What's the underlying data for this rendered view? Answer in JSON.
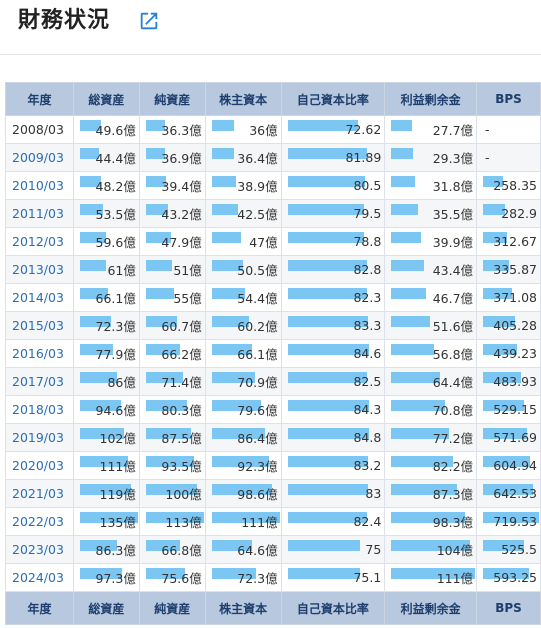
{
  "header": {
    "title": "財務状況",
    "link_icon": "external-link-icon"
  },
  "table": {
    "columns": [
      "年度",
      "総資産",
      "純資産",
      "株主資本",
      "自己資本比率",
      "利益剰余金",
      "BPS"
    ],
    "bar_color": "#7cc6f3",
    "max": {
      "total_assets": 135,
      "net_assets": 113,
      "shareholders_equity": 111,
      "equity_ratio": 100,
      "retained_earnings": 111,
      "bps": 719.53
    },
    "rows": [
      {
        "year": "2008/03",
        "linked": false,
        "total_assets": "49.6億",
        "net_assets": "36.3億",
        "shareholders_equity": "36億",
        "equity_ratio": "72.62",
        "retained_earnings": "27.7億",
        "bps": "-"
      },
      {
        "year": "2009/03",
        "linked": true,
        "total_assets": "44.4億",
        "net_assets": "36.9億",
        "shareholders_equity": "36.4億",
        "equity_ratio": "81.89",
        "retained_earnings": "29.3億",
        "bps": "-"
      },
      {
        "year": "2010/03",
        "linked": true,
        "total_assets": "48.2億",
        "net_assets": "39.4億",
        "shareholders_equity": "38.9億",
        "equity_ratio": "80.5",
        "retained_earnings": "31.8億",
        "bps": "258.35"
      },
      {
        "year": "2011/03",
        "linked": true,
        "total_assets": "53.5億",
        "net_assets": "43.2億",
        "shareholders_equity": "42.5億",
        "equity_ratio": "79.5",
        "retained_earnings": "35.5億",
        "bps": "282.9"
      },
      {
        "year": "2012/03",
        "linked": true,
        "total_assets": "59.6億",
        "net_assets": "47.9億",
        "shareholders_equity": "47億",
        "equity_ratio": "78.8",
        "retained_earnings": "39.9億",
        "bps": "312.67"
      },
      {
        "year": "2013/03",
        "linked": true,
        "total_assets": "61億",
        "net_assets": "51億",
        "shareholders_equity": "50.5億",
        "equity_ratio": "82.8",
        "retained_earnings": "43.4億",
        "bps": "335.87"
      },
      {
        "year": "2014/03",
        "linked": true,
        "total_assets": "66.1億",
        "net_assets": "55億",
        "shareholders_equity": "54.4億",
        "equity_ratio": "82.3",
        "retained_earnings": "46.7億",
        "bps": "371.08"
      },
      {
        "year": "2015/03",
        "linked": true,
        "total_assets": "72.3億",
        "net_assets": "60.7億",
        "shareholders_equity": "60.2億",
        "equity_ratio": "83.3",
        "retained_earnings": "51.6億",
        "bps": "405.28"
      },
      {
        "year": "2016/03",
        "linked": true,
        "total_assets": "77.9億",
        "net_assets": "66.2億",
        "shareholders_equity": "66.1億",
        "equity_ratio": "84.6",
        "retained_earnings": "56.8億",
        "bps": "439.23"
      },
      {
        "year": "2017/03",
        "linked": true,
        "total_assets": "86億",
        "net_assets": "71.4億",
        "shareholders_equity": "70.9億",
        "equity_ratio": "82.5",
        "retained_earnings": "64.4億",
        "bps": "483.93"
      },
      {
        "year": "2018/03",
        "linked": true,
        "total_assets": "94.6億",
        "net_assets": "80.3億",
        "shareholders_equity": "79.6億",
        "equity_ratio": "84.3",
        "retained_earnings": "70.8億",
        "bps": "529.15"
      },
      {
        "year": "2019/03",
        "linked": true,
        "total_assets": "102億",
        "net_assets": "87.5億",
        "shareholders_equity": "86.4億",
        "equity_ratio": "84.8",
        "retained_earnings": "77.2億",
        "bps": "571.69"
      },
      {
        "year": "2020/03",
        "linked": true,
        "total_assets": "111億",
        "net_assets": "93.5億",
        "shareholders_equity": "92.3億",
        "equity_ratio": "83.2",
        "retained_earnings": "82.2億",
        "bps": "604.94"
      },
      {
        "year": "2021/03",
        "linked": true,
        "total_assets": "119億",
        "net_assets": "100億",
        "shareholders_equity": "98.6億",
        "equity_ratio": "83",
        "retained_earnings": "87.3億",
        "bps": "642.53"
      },
      {
        "year": "2022/03",
        "linked": true,
        "total_assets": "135億",
        "net_assets": "113億",
        "shareholders_equity": "111億",
        "equity_ratio": "82.4",
        "retained_earnings": "98.3億",
        "bps": "719.53"
      },
      {
        "year": "2023/03",
        "linked": true,
        "total_assets": "86.3億",
        "net_assets": "66.8億",
        "shareholders_equity": "64.6億",
        "equity_ratio": "75",
        "retained_earnings": "104億",
        "bps": "525.5"
      },
      {
        "year": "2024/03",
        "linked": true,
        "total_assets": "97.3億",
        "net_assets": "75.6億",
        "shareholders_equity": "72.3億",
        "equity_ratio": "75.1",
        "retained_earnings": "111億",
        "bps": "593.25"
      }
    ]
  }
}
